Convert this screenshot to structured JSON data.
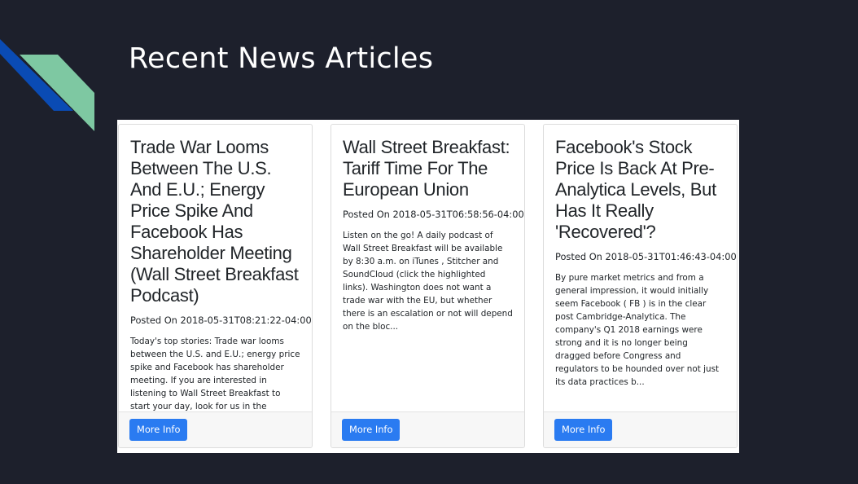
{
  "page": {
    "title": "Recent News Articles"
  },
  "cards": [
    {
      "title": "Trade War Looms Between The U.S. And E.U.; Energy Price Spike And Facebook Has Shareholder Meeting (Wall Street Breakfast Podcast)",
      "date": "Posted On 2018-05-31T08:21:22-04:00",
      "summary": "Today's top stories: Trade war looms between the U.S. and E.U.; energy price spike and Facebook has shareholder meeting. If you are interested in listening to Wall Street Breakfast to start your day, look for us in the following places: iTunes (find all Seeking Alpha Podcast...",
      "button_label": "More Info"
    },
    {
      "title": "Wall Street Breakfast: Tariff Time For The European Union",
      "date": "Posted On 2018-05-31T06:58:56-04:00",
      "summary": "Listen on the go! A daily podcast of Wall Street Breakfast will be available by 8:30 a.m. on iTunes , Stitcher and SoundCloud (click the highlighted links). Washington does not want a trade war with the EU, but whether there is an escalation or not will depend on the bloc...",
      "button_label": "More Info"
    },
    {
      "title": "Facebook's Stock Price Is Back At Pre-Analytica Levels, But Has It Really 'Recovered'?",
      "date": "Posted On 2018-05-31T01:46:43-04:00",
      "summary": "By pure market metrics and from a general impression, it would initially seem Facebook ( FB ) is in the clear post Cambridge-Analytica. The company's Q1 2018 earnings were strong and it is no longer being dragged before Congress and regulators to be hounded over not just its data practices b...",
      "button_label": "More Info"
    }
  ],
  "colors": {
    "background": "#1d202c",
    "accent_blue": "#0a4bb4",
    "accent_green": "#7ec8a2",
    "button": "#2a7bf1"
  }
}
